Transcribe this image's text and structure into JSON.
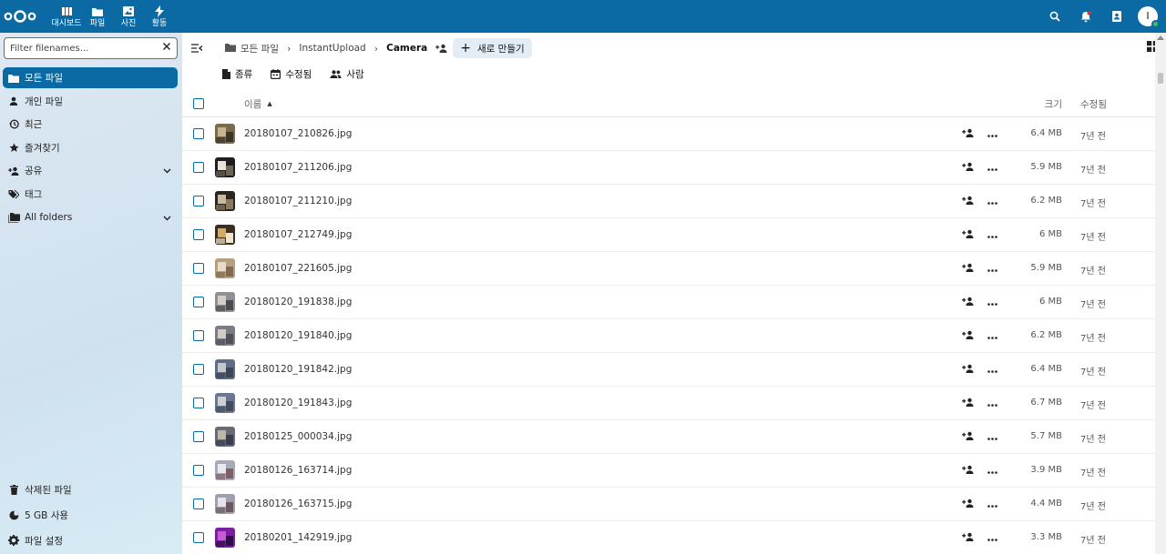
{
  "header": {
    "apps": [
      {
        "label": "대시보드",
        "icon": "dashboard-icon"
      },
      {
        "label": "파일",
        "icon": "folder-icon"
      },
      {
        "label": "사진",
        "icon": "image-icon"
      },
      {
        "label": "활동",
        "icon": "lightning-icon"
      }
    ],
    "brand_color": "#0b6aa4"
  },
  "sidebar": {
    "filter_placeholder": "Filter filenames...",
    "items": [
      {
        "label": "모든 파일",
        "icon": "folder-icon",
        "active": true
      },
      {
        "label": "개인 파일",
        "icon": "person-icon"
      },
      {
        "label": "최근",
        "icon": "history-icon"
      },
      {
        "label": "즐겨찾기",
        "icon": "star-icon"
      },
      {
        "label": "공유",
        "icon": "share-icon",
        "expandable": true
      },
      {
        "label": "태그",
        "icon": "tag-icon"
      },
      {
        "label": "All folders",
        "icon": "folders-icon",
        "expandable": true
      }
    ],
    "bottom": [
      {
        "label": "삭제된 파일",
        "icon": "trash-icon"
      },
      {
        "label": "5 GB 사용",
        "icon": "pie-icon"
      },
      {
        "label": "파일 설정",
        "icon": "gear-icon"
      }
    ]
  },
  "breadcrumb": {
    "home": "모든 파일",
    "items": [
      "InstantUpload",
      "Camera"
    ]
  },
  "new_button": "새로 만들기",
  "filters": [
    "종류",
    "수정됨",
    "사람"
  ],
  "table": {
    "col_name": "이름",
    "col_size": "크기",
    "col_modified": "수정됨",
    "rows": [
      {
        "name": "20180107_210826.jpg",
        "size": "6.4 MB",
        "modified": "7년 전",
        "thumb": [
          "#7a6a4e",
          "#c9b58d",
          "#3b3328"
        ]
      },
      {
        "name": "20180107_211206.jpg",
        "size": "5.9 MB",
        "modified": "7년 전",
        "thumb": [
          "#1e1e1e",
          "#e8e4da",
          "#6d6657"
        ]
      },
      {
        "name": "20180107_211210.jpg",
        "size": "6.2 MB",
        "modified": "7년 전",
        "thumb": [
          "#2b2520",
          "#c8b9a0",
          "#8b7a5c"
        ]
      },
      {
        "name": "20180107_212749.jpg",
        "size": "6 MB",
        "modified": "7년 전",
        "thumb": [
          "#3a2e1e",
          "#d6a860",
          "#f0e5cc"
        ]
      },
      {
        "name": "20180107_221605.jpg",
        "size": "5.9 MB",
        "modified": "7년 전",
        "thumb": [
          "#b7a080",
          "#e6dccb",
          "#7e6a4c"
        ]
      },
      {
        "name": "20180120_191838.jpg",
        "size": "6 MB",
        "modified": "7년 전",
        "thumb": [
          "#8f8f94",
          "#d2cfc8",
          "#4a4a50"
        ]
      },
      {
        "name": "20180120_191840.jpg",
        "size": "6.2 MB",
        "modified": "7년 전",
        "thumb": [
          "#7b7c84",
          "#cfcbc4",
          "#505058"
        ]
      },
      {
        "name": "20180120_191842.jpg",
        "size": "6.4 MB",
        "modified": "7년 전",
        "thumb": [
          "#5e6c85",
          "#c4c7cc",
          "#3c4557"
        ]
      },
      {
        "name": "20180120_191843.jpg",
        "size": "6.7 MB",
        "modified": "7년 전",
        "thumb": [
          "#6b7791",
          "#cfd0d3",
          "#444b5c"
        ]
      },
      {
        "name": "20180125_000034.jpg",
        "size": "5.7 MB",
        "modified": "7년 전",
        "thumb": [
          "#6a6a76",
          "#c0b6a4",
          "#3a3d52"
        ]
      },
      {
        "name": "20180126_163714.jpg",
        "size": "3.9 MB",
        "modified": "7년 전",
        "thumb": [
          "#a7aab7",
          "#eaeaee",
          "#7d5f6a"
        ]
      },
      {
        "name": "20180126_163715.jpg",
        "size": "4.4 MB",
        "modified": "7년 전",
        "thumb": [
          "#9ea1ad",
          "#e4e4e9",
          "#6e5763"
        ]
      },
      {
        "name": "20180201_142919.jpg",
        "size": "3.3 MB",
        "modified": "7년 전",
        "thumb": [
          "#7a1f9e",
          "#c85ad8",
          "#2e0f43"
        ]
      }
    ]
  }
}
